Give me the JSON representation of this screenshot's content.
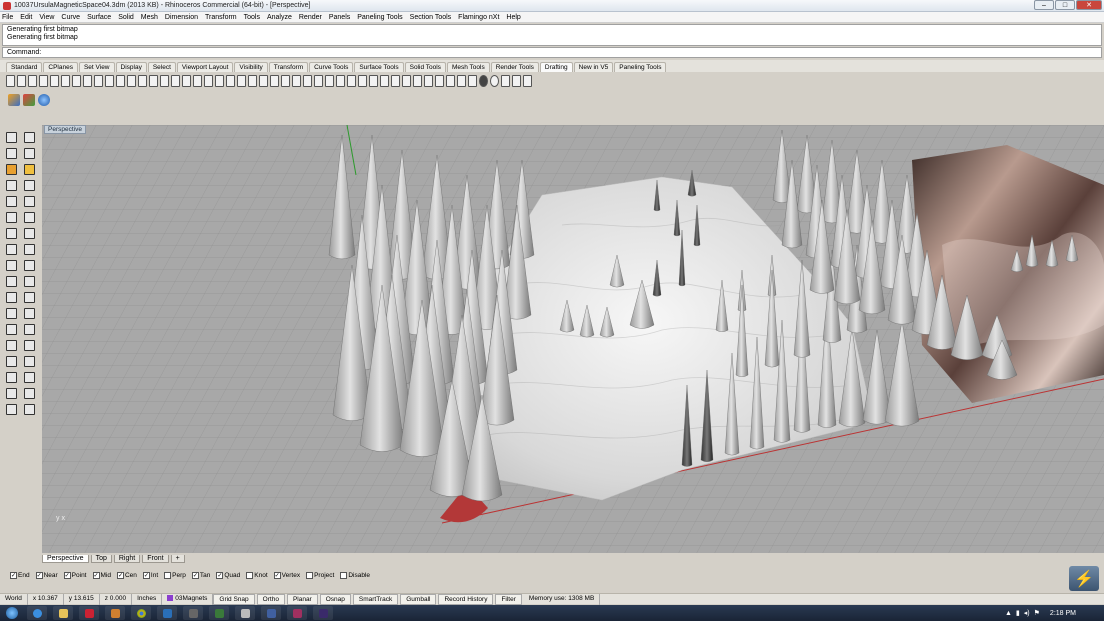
{
  "title_bar": {
    "title": "10037UrsulaMagneticSpace04.3dm (2013 KB) - Rhinoceros Commercial (64-bit) - [Perspective]"
  },
  "menu": [
    "File",
    "Edit",
    "View",
    "Curve",
    "Surface",
    "Solid",
    "Mesh",
    "Dimension",
    "Transform",
    "Tools",
    "Analyze",
    "Render",
    "Panels",
    "Paneling Tools",
    "Section Tools",
    "Flamingo nXt",
    "Help"
  ],
  "command_history": [
    "Generating first bitmap",
    "Generating first bitmap"
  ],
  "command_prompt": "Command:",
  "toolbar_tabs": [
    {
      "label": "Standard"
    },
    {
      "label": "CPlanes"
    },
    {
      "label": "Set View"
    },
    {
      "label": "Display"
    },
    {
      "label": "Select"
    },
    {
      "label": "Viewport Layout"
    },
    {
      "label": "Visibility"
    },
    {
      "label": "Transform"
    },
    {
      "label": "Curve Tools"
    },
    {
      "label": "Surface Tools"
    },
    {
      "label": "Solid Tools"
    },
    {
      "label": "Mesh Tools"
    },
    {
      "label": "Render Tools"
    },
    {
      "label": "Drafting",
      "active": true
    },
    {
      "label": "New in V5"
    },
    {
      "label": "Paneling Tools"
    }
  ],
  "viewport": {
    "label": "Perspective",
    "axis_x": "x",
    "axis_y": "y"
  },
  "viewport_tabs": [
    {
      "label": "Perspective",
      "active": true
    },
    {
      "label": "Top"
    },
    {
      "label": "Right"
    },
    {
      "label": "Front"
    },
    {
      "label": "+"
    }
  ],
  "osnaps": [
    {
      "label": "End",
      "checked": true
    },
    {
      "label": "Near",
      "checked": true
    },
    {
      "label": "Point",
      "checked": true
    },
    {
      "label": "Mid",
      "checked": true
    },
    {
      "label": "Cen",
      "checked": true
    },
    {
      "label": "Int",
      "checked": true
    },
    {
      "label": "Perp",
      "checked": false
    },
    {
      "label": "Tan",
      "checked": true
    },
    {
      "label": "Quad",
      "checked": true
    },
    {
      "label": "Knot",
      "checked": false
    },
    {
      "label": "Vertex",
      "checked": true
    },
    {
      "label": "Project",
      "checked": false
    },
    {
      "label": "Disable",
      "checked": false
    }
  ],
  "status": {
    "cplane": "World",
    "x": "x 10.367",
    "y": "y 13.615",
    "z": "z 0.000",
    "units": "Inches",
    "layer": "03Magnets",
    "grid_snap": "Grid Snap",
    "ortho": "Ortho",
    "planar": "Planar",
    "osnap": "Osnap",
    "smarttrack": "SmartTrack",
    "gumball": "Gumball",
    "record_history": "Record History",
    "filter": "Filter",
    "memory": "Memory use: 1308 MB"
  },
  "taskbar": {
    "clock": "2:18 PM"
  }
}
